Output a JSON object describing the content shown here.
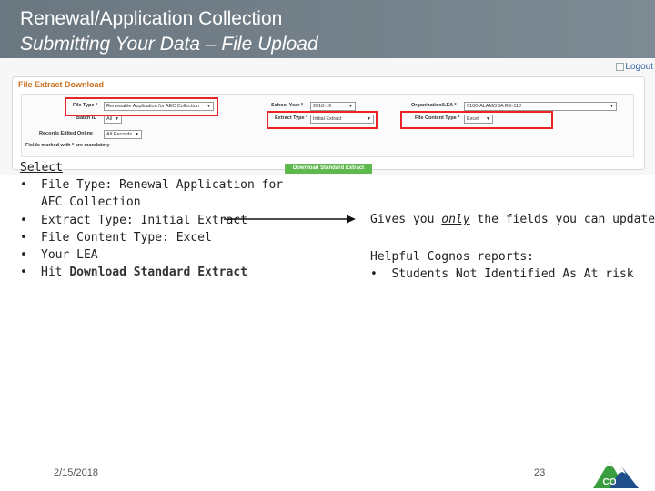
{
  "header": {
    "title": "Renewal/Application Collection",
    "subtitle": "Submitting Your Data – File Upload"
  },
  "screenshot": {
    "logout_label": "Logout",
    "panel_title": "File Extract Download",
    "file_type": {
      "label": "File Type",
      "value": "Renewable Application for AEC Collection"
    },
    "school_year": {
      "label": "School Year",
      "value": "2018-19"
    },
    "org_lea": {
      "label": "Organization/LEA",
      "value": "0100-ALAMOSA RE-11J"
    },
    "batch_id": {
      "label": "Batch ID",
      "value": "All"
    },
    "extract_type": {
      "label": "Extract Type",
      "value": "Initial Extract"
    },
    "file_content_type": {
      "label": "File Content Type",
      "value": "Excel"
    },
    "records_edited": {
      "label": "Records Edited Online",
      "value": "All Records"
    },
    "mandatory_note": "Fields marked with * are mandatory",
    "download_button": "Download Standard Extract",
    "highlight_color": "#e8262a"
  },
  "left": {
    "heading": "Select",
    "bullet": "•",
    "items": [
      "File Type: Renewal Application for AEC Collection",
      "Extract Type: Initial Extract",
      "File Content Type: Excel",
      "Your LEA"
    ],
    "last_prefix": "Hit ",
    "last_bold": "Download Standard Extract"
  },
  "right": {
    "line1_before": "Gives you ",
    "line1_only": "only",
    "line1_after": " the fields you can update",
    "cognos_heading": "Helpful Cognos reports:",
    "cognos_item": "Students Not Identified As At risk"
  },
  "footer": {
    "date": "2/15/2018",
    "page_number": "23",
    "logo_text": "CO",
    "logo_colors": {
      "green": "#3a9d3f",
      "blue": "#1f4f8a"
    }
  }
}
